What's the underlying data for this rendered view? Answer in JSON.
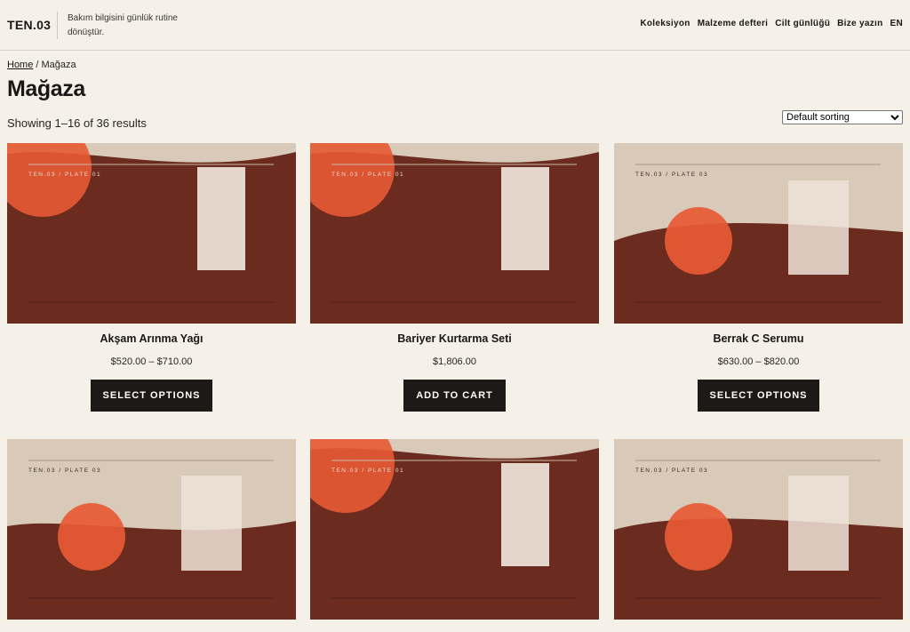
{
  "site": {
    "logo": "TEN.03",
    "tagline": "Bakım bilgisini günlük rutine dönüştür."
  },
  "nav": {
    "items": [
      "Koleksiyon",
      "Malzeme defteri",
      "Cilt günlüğü",
      "Bize yazın",
      "EN"
    ]
  },
  "breadcrumb": {
    "home": "Home",
    "separator": " / ",
    "current": "Mağaza"
  },
  "page": {
    "title": "Mağaza",
    "result_count": "Showing 1–16 of 36 results",
    "sorting_selected": "Default sorting"
  },
  "colors": {
    "background": "#f5f0e8",
    "plate_dark": "#6b2b1f",
    "plate_light": "#d8c9b8",
    "accent_circle": "#e85a34",
    "button": "#1c1917"
  },
  "products": [
    {
      "name": "Akşam Arınma Yağı",
      "price": "$520.00 – $710.00",
      "button": "SELECT OPTIONS",
      "plate_label": "TEN.03 / PLATE 01"
    },
    {
      "name": "Bariyer Kurtarma Seti",
      "price": "$1,806.00",
      "button": "ADD TO CART",
      "plate_label": "TEN.03 / PLATE 01"
    },
    {
      "name": "Berrak C Serumu",
      "price": "$630.00 – $820.00",
      "button": "SELECT OPTIONS",
      "plate_label": "TEN.03 / PLATE 03"
    },
    {
      "plate_label": "TEN.03 / PLATE 03"
    },
    {
      "plate_label": "TEN.03 / PLATE 01"
    },
    {
      "plate_label": "TEN.03 / PLATE 03"
    }
  ]
}
